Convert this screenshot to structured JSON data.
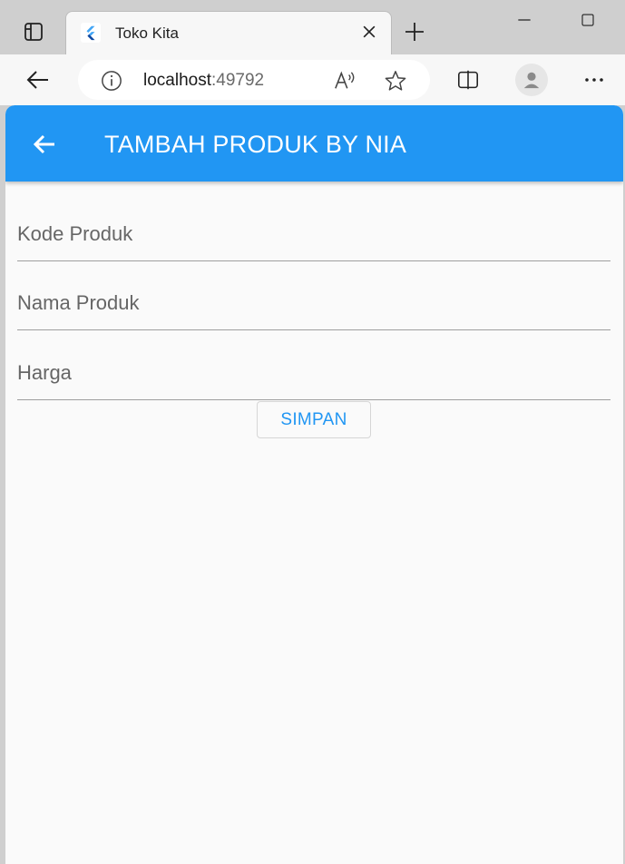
{
  "browser": {
    "tab": {
      "title": "Toko Kita",
      "favicon": "flutter-icon"
    },
    "address": {
      "host": "localhost",
      "port": ":49792"
    },
    "icons": [
      "tab-actions-icon",
      "close-icon",
      "plus-icon",
      "minimize-icon",
      "maximize-icon",
      "back-arrow-icon",
      "info-icon",
      "read-aloud-icon",
      "star-icon",
      "split-screen-icon",
      "profile-icon",
      "more-icon"
    ]
  },
  "app": {
    "appbar": {
      "title": "TAMBAH PRODUK BY NIA",
      "back_icon": "back-arrow-icon",
      "color": "#2196f3"
    },
    "form": {
      "kode_placeholder": "Kode Produk",
      "nama_placeholder": "Nama Produk",
      "harga_placeholder": "Harga",
      "submit_label": "SIMPAN"
    }
  }
}
